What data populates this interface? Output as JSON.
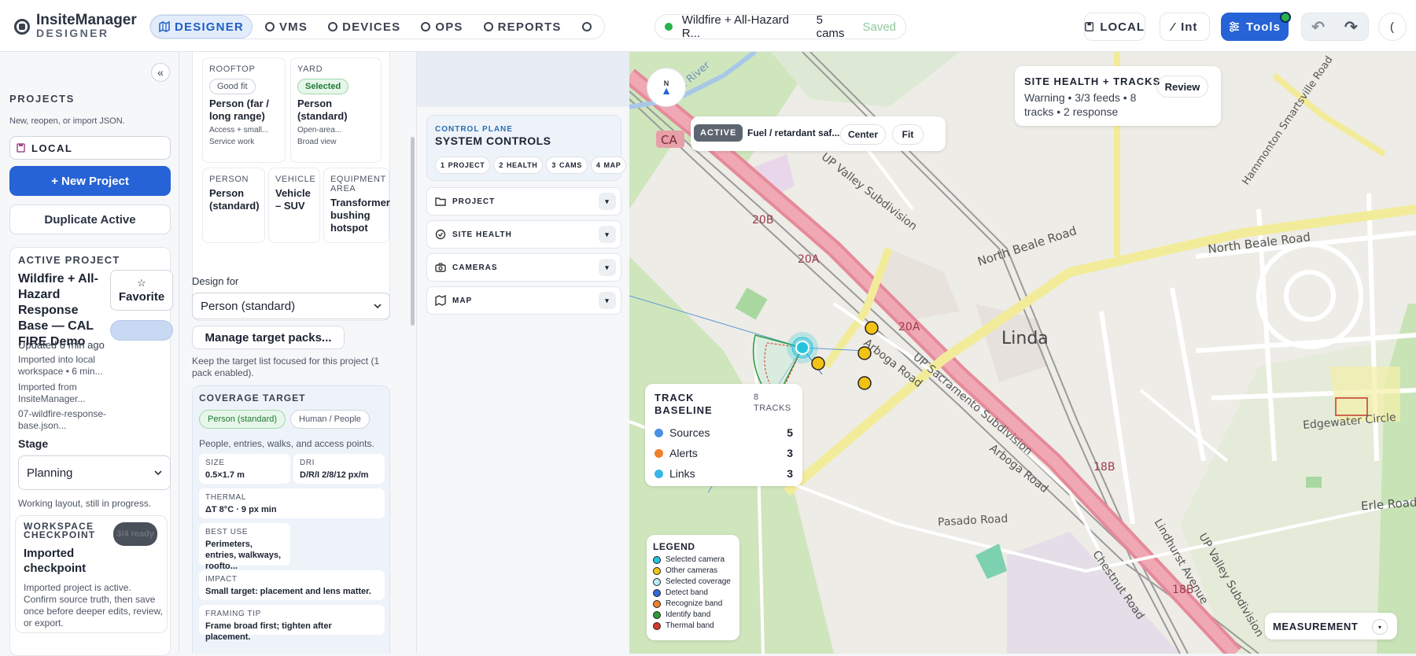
{
  "brand": {
    "name": "InsiteManager",
    "sub": "DESIGNER"
  },
  "nav": [
    "DESIGNER",
    "VMS",
    "DEVICES",
    "OPS",
    "REPORTS"
  ],
  "project_pill": {
    "name": "Wildfire + All-Hazard R...",
    "cams": "5 cams",
    "status": "Saved"
  },
  "toolbar": {
    "local": "LOCAL",
    "int": "Int",
    "tools": "Tools",
    "collapse": "("
  },
  "sidebar": {
    "collapse": "«",
    "projects_heading": "PROJECTS",
    "projects_sub": "New, reopen, or import JSON.",
    "workspace": "LOCAL",
    "new_project": "+ New Project",
    "duplicate": "Duplicate Active",
    "active": {
      "heading": "ACTIVE PROJECT",
      "name": "Wildfire + All-Hazard Response Base — CAL FIRE Demo",
      "favorite_icon": "☆",
      "favorite": "Favorite",
      "updated": "Updated 6 min ago",
      "imported_local": "Imported into local workspace • 6 min...",
      "imported_from": "Imported from InsiteManager...",
      "file": "07-wildfire-response-base.json...",
      "stage_label": "Stage",
      "stage_value": "Planning",
      "stage_help": "Working layout, still in progress."
    },
    "checkpoint": {
      "heading": "WORKSPACE CHECKPOINT",
      "badge": "3/4 ready",
      "title": "Imported checkpoint",
      "body": "Imported project is active. Confirm source truth, then save once before deeper edits, review, or export."
    }
  },
  "targets": {
    "cards": [
      {
        "cap": "ROOFTOP",
        "tag": "Good fit",
        "name": "Person (far / long range)",
        "sub1": "Access + small...",
        "sub2": "Service work"
      },
      {
        "cap": "YARD",
        "tag": "Selected",
        "name": "Person (standard)",
        "sub1": "Open-area...",
        "sub2": "Broad view"
      },
      {
        "cap": "PERSON",
        "name": "Person (standard)"
      },
      {
        "cap": "VEHICLE",
        "name": "Vehicle – SUV"
      },
      {
        "cap": "EQUIPMENT AREA",
        "name": "Transformer bushing hotspot"
      }
    ],
    "design_for_label": "Design for",
    "design_for_value": "Person (standard)",
    "manage": "Manage target packs...",
    "help": "Keep the target list focused for this project (1 pack enabled).",
    "coverage": {
      "heading": "COVERAGE TARGET",
      "tags": [
        "Person (standard)",
        "Human / People"
      ],
      "desc": "People, entries, walks, and access points.",
      "stats": [
        {
          "k": "SIZE",
          "v": "0.5×1.7 m"
        },
        {
          "k": "DRI",
          "v": "D/R/I 2/8/12 px/m"
        },
        {
          "k": "THERMAL",
          "v": "ΔT 8°C · 9 px min"
        },
        {
          "k": "BEST USE",
          "v": "Perimeters, entries, walkways, roofto..."
        },
        {
          "k": "IMPACT",
          "v": "Small target: placement and lens matter."
        },
        {
          "k": "FRAMING TIP",
          "v": "Frame broad first; tighten after placement."
        }
      ]
    }
  },
  "control_plane": {
    "eyebrow": "CONTROL PLANE",
    "title": "SYSTEM CONTROLS",
    "steps": [
      {
        "n": "1",
        "l": "PROJECT"
      },
      {
        "n": "2",
        "l": "HEALTH"
      },
      {
        "n": "3",
        "l": "CAMS"
      },
      {
        "n": "4",
        "l": "MAP"
      }
    ],
    "sections": [
      "PROJECT",
      "SITE HEALTH",
      "CAMERAS",
      "MAP"
    ]
  },
  "map": {
    "compass": "N",
    "active_badge": "ACTIVE",
    "active_text": "Fuel / retardant saf...",
    "center": "Center",
    "fit": "Fit",
    "health_heading": "SITE HEALTH + TRACKS",
    "health_body": "Warning • 3/3 feeds • 8 tracks • 2 response",
    "review": "Review",
    "track_heading": "TRACK BASELINE",
    "track_count": "8 TRACKS",
    "track_rows": [
      {
        "label": "Sources",
        "value": "5",
        "color": "#4a90e2"
      },
      {
        "label": "Alerts",
        "value": "3",
        "color": "#f07f2a"
      },
      {
        "label": "Links",
        "value": "3",
        "color": "#3bb5e8"
      }
    ],
    "legend_heading": "LEGEND",
    "legend": [
      {
        "label": "Selected camera",
        "color": "#22c4dc"
      },
      {
        "label": "Other cameras",
        "color": "#f2c314"
      },
      {
        "label": "Selected coverage",
        "color": "#b8eef6"
      },
      {
        "label": "Detect band",
        "color": "#2f6bd8"
      },
      {
        "label": "Recognize band",
        "color": "#f07f2a"
      },
      {
        "label": "Identify band",
        "color": "#2e9a3a"
      },
      {
        "label": "Thermal band",
        "color": "#d43a2c"
      }
    ],
    "measurement": "MEASUREMENT",
    "labels": {
      "linda": "Linda",
      "north_beale": "North Beale Road",
      "north_beale2": "North Beale Road",
      "erle": "Erle Road",
      "pasado": "Pasado Road",
      "edgewater": "Edgewater Circle",
      "arboga": "Arboga Road",
      "arboga2": "Arboga Road",
      "up_valley": "UP Valley Subdivision",
      "up_valley2": "UP Valley Subdivision",
      "up_sac": "UP Sacramento Subdivision",
      "chestnut": "Chestnut Road",
      "lindhurst": "Lindhurst Avenue",
      "hammonton": "Hammonton Smartsville Road",
      "yuba": "Yuba River",
      "r20b": "20B",
      "r20a": "20A",
      "r20a2": "20A",
      "r18b": "18B",
      "r18b2": "18B",
      "ca": "CA"
    }
  }
}
